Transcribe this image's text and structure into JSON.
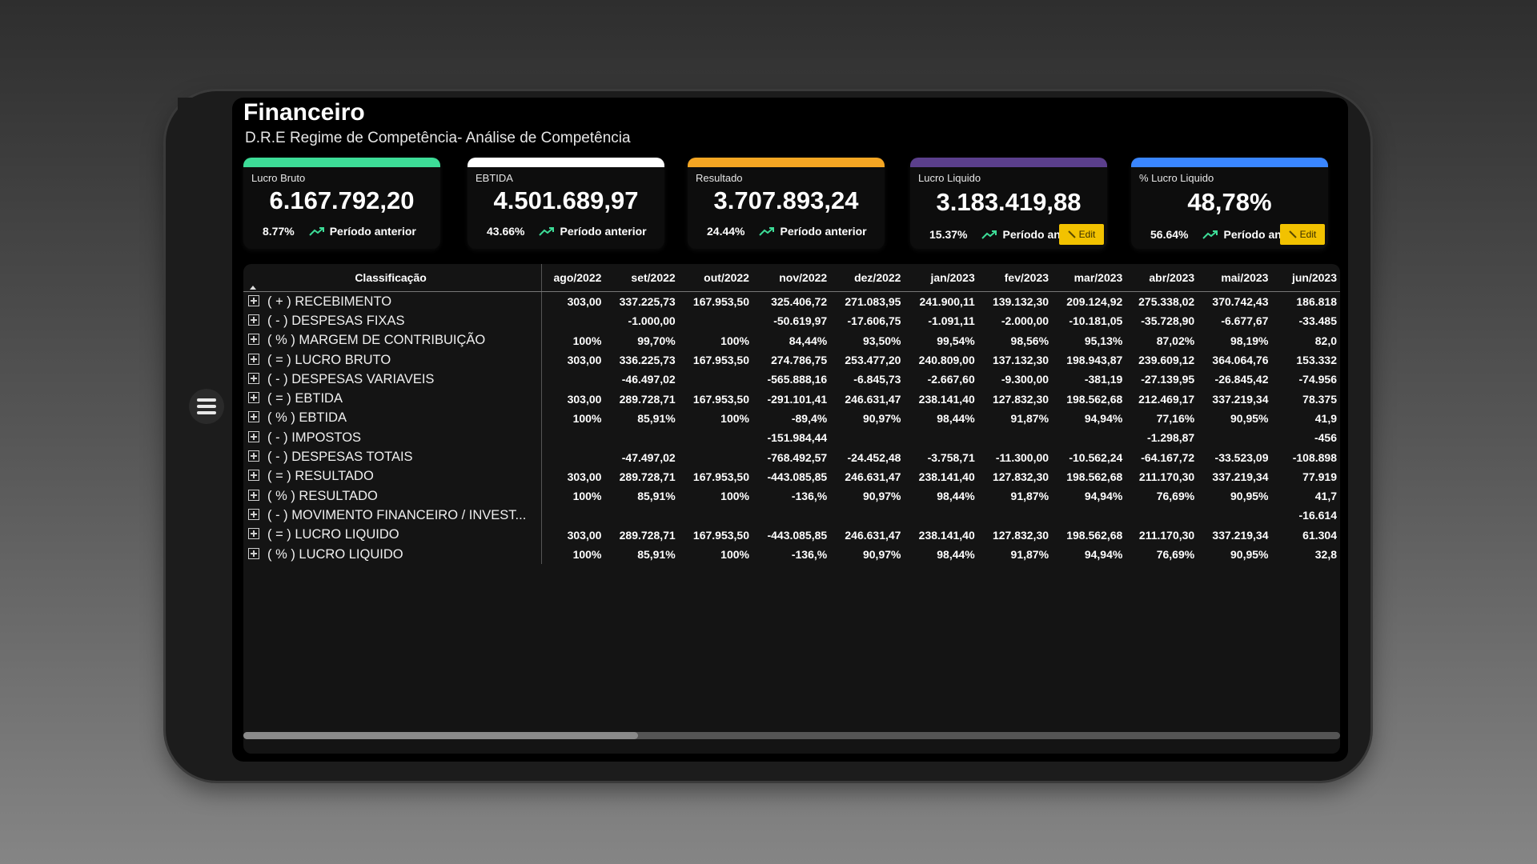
{
  "header": {
    "title": "Financeiro",
    "subtitle": "D.R.E Regime de Competência- Análise de Competência"
  },
  "cards": [
    {
      "label": "Lucro Bruto",
      "value": "6.167.792,20",
      "change": "8.77%",
      "comparison": "Período anterior",
      "color": "#3ddc97"
    },
    {
      "label": "EBTIDA",
      "value": "4.501.689,97",
      "change": "43.66%",
      "comparison": "Período anterior",
      "color": "#ffffff"
    },
    {
      "label": "Resultado",
      "value": "3.707.893,24",
      "change": "24.44%",
      "comparison": "Período anterior",
      "color": "#f5a623"
    },
    {
      "label": "Lucro Liquido",
      "value": "3.183.419,88",
      "change": "15.37%",
      "comparison": "Período an",
      "color": "#5b3f8c",
      "edit_label": "Edit"
    },
    {
      "label": "% Lucro Liquido",
      "value": "48,78%",
      "change": "56.64%",
      "comparison": "Período an",
      "color": "#3a86ff",
      "edit_label": "Edit"
    }
  ],
  "trend_color": "#3ddc97",
  "table": {
    "class_header": "Classificação",
    "columns": [
      "ago/2022",
      "set/2022",
      "out/2022",
      "nov/2022",
      "dez/2022",
      "jan/2023",
      "fev/2023",
      "mar/2023",
      "abr/2023",
      "mai/2023",
      "jun/2023"
    ],
    "rows": [
      {
        "label": "( + ) RECEBIMENTO",
        "values": [
          "303,00",
          "337.225,73",
          "167.953,50",
          "325.406,72",
          "271.083,95",
          "241.900,11",
          "139.132,30",
          "209.124,92",
          "275.338,02",
          "370.742,43",
          "186.818"
        ]
      },
      {
        "label": "( - ) DESPESAS FIXAS",
        "values": [
          "",
          "-1.000,00",
          "",
          "-50.619,97",
          "-17.606,75",
          "-1.091,11",
          "-2.000,00",
          "-10.181,05",
          "-35.728,90",
          "-6.677,67",
          "-33.485"
        ]
      },
      {
        "label": "( % ) MARGEM DE CONTRIBUIÇÃO",
        "values": [
          "100%",
          "99,70%",
          "100%",
          "84,44%",
          "93,50%",
          "99,54%",
          "98,56%",
          "95,13%",
          "87,02%",
          "98,19%",
          "82,0"
        ]
      },
      {
        "label": "( = ) LUCRO BRUTO",
        "values": [
          "303,00",
          "336.225,73",
          "167.953,50",
          "274.786,75",
          "253.477,20",
          "240.809,00",
          "137.132,30",
          "198.943,87",
          "239.609,12",
          "364.064,76",
          "153.332"
        ]
      },
      {
        "label": "( - ) DESPESAS VARIAVEIS",
        "values": [
          "",
          "-46.497,02",
          "",
          "-565.888,16",
          "-6.845,73",
          "-2.667,60",
          "-9.300,00",
          "-381,19",
          "-27.139,95",
          "-26.845,42",
          "-74.956"
        ]
      },
      {
        "label": "( = ) EBTIDA",
        "values": [
          "303,00",
          "289.728,71",
          "167.953,50",
          "-291.101,41",
          "246.631,47",
          "238.141,40",
          "127.832,30",
          "198.562,68",
          "212.469,17",
          "337.219,34",
          "78.375"
        ]
      },
      {
        "label": "( % ) EBTIDA",
        "values": [
          "100%",
          "85,91%",
          "100%",
          "-89,4%",
          "90,97%",
          "98,44%",
          "91,87%",
          "94,94%",
          "77,16%",
          "90,95%",
          "41,9"
        ]
      },
      {
        "label": "( - ) IMPOSTOS",
        "values": [
          "",
          "",
          "",
          "-151.984,44",
          "",
          "",
          "",
          "",
          "-1.298,87",
          "",
          "-456"
        ]
      },
      {
        "label": "( - ) DESPESAS TOTAIS",
        "values": [
          "",
          "-47.497,02",
          "",
          "-768.492,57",
          "-24.452,48",
          "-3.758,71",
          "-11.300,00",
          "-10.562,24",
          "-64.167,72",
          "-33.523,09",
          "-108.898"
        ]
      },
      {
        "label": "( = ) RESULTADO",
        "values": [
          "303,00",
          "289.728,71",
          "167.953,50",
          "-443.085,85",
          "246.631,47",
          "238.141,40",
          "127.832,30",
          "198.562,68",
          "211.170,30",
          "337.219,34",
          "77.919"
        ]
      },
      {
        "label": "( % ) RESULTADO",
        "values": [
          "100%",
          "85,91%",
          "100%",
          "-136,%",
          "90,97%",
          "98,44%",
          "91,87%",
          "94,94%",
          "76,69%",
          "90,95%",
          "41,7"
        ]
      },
      {
        "label": "( - ) MOVIMENTO FINANCEIRO / INVEST...",
        "values": [
          "",
          "",
          "",
          "",
          "",
          "",
          "",
          "",
          "",
          "",
          "-16.614"
        ]
      },
      {
        "label": "( = ) LUCRO LIQUIDO",
        "values": [
          "303,00",
          "289.728,71",
          "167.953,50",
          "-443.085,85",
          "246.631,47",
          "238.141,40",
          "127.832,30",
          "198.562,68",
          "211.170,30",
          "337.219,34",
          "61.304"
        ]
      },
      {
        "label": "( % ) LUCRO LIQUIDO",
        "values": [
          "100%",
          "85,91%",
          "100%",
          "-136,%",
          "90,97%",
          "98,44%",
          "91,87%",
          "94,94%",
          "76,69%",
          "90,95%",
          "32,8"
        ]
      }
    ]
  },
  "scroll": {
    "horizontal_position": 0.36
  }
}
